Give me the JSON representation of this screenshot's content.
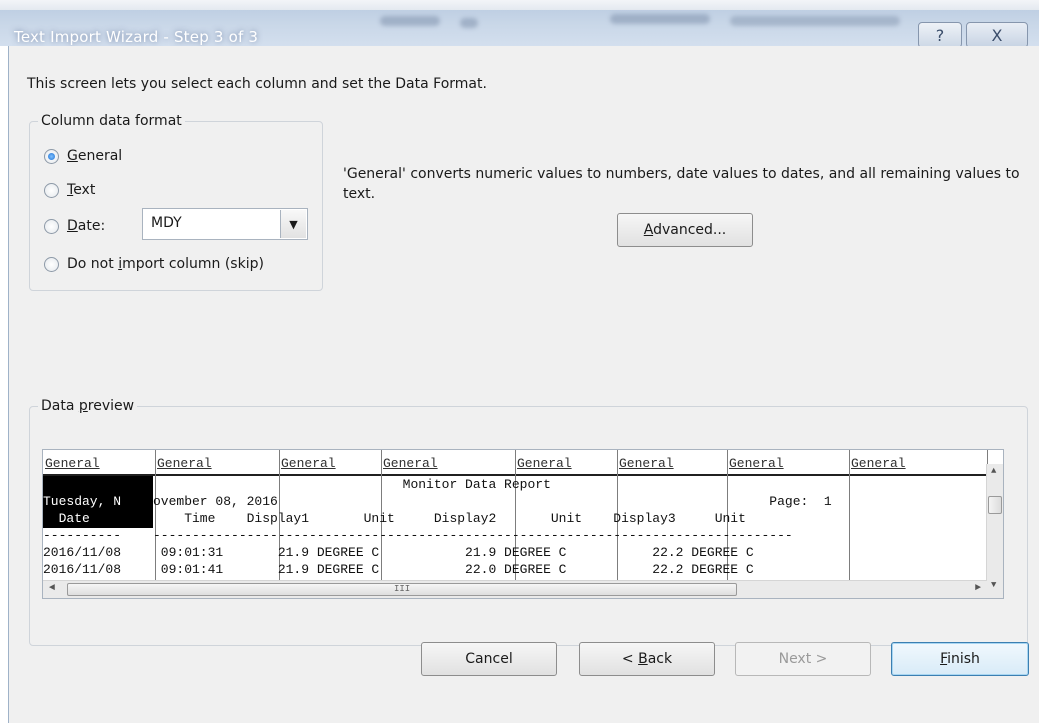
{
  "window": {
    "title": "Text Import Wizard - Step 3 of 3",
    "help_glyph": "?",
    "close_glyph": "X"
  },
  "intro_text": "This screen lets you select each column and set the Data Format.",
  "column_format": {
    "legend": "Column data format",
    "options": [
      {
        "label_mn": "G",
        "label_rest": "eneral",
        "checked": true
      },
      {
        "label_mn": "T",
        "label_rest": "ext",
        "checked": false
      },
      {
        "label_mn": "D",
        "label_rest": "ate:",
        "checked": false
      },
      {
        "label_pre": "Do not ",
        "label_mn": "i",
        "label_rest": "mport column (skip)",
        "checked": false
      }
    ],
    "date_format_value": "MDY",
    "dropdown_glyph": "▼"
  },
  "description": "'General' converts numeric values to numbers, date values to dates, and all remaining values to text.",
  "advanced_button": {
    "mn": "A",
    "rest": "dvanced..."
  },
  "data_preview": {
    "legend_pre": "Data ",
    "legend_mn": "p",
    "legend_rest": "review",
    "headers": [
      "General",
      "General",
      "General",
      "General",
      "General",
      "General",
      "General",
      "General"
    ],
    "col0_lines": [
      "",
      "Tuesday, N",
      "  Date",
      "----------",
      "2016/11/08",
      "2016/11/08"
    ],
    "rest_lines": [
      "                                Monitor Data Report",
      "ovember 08, 2016                                                               Page:  1",
      "    Time    Display1       Unit     Display2       Unit    Display3     Unit",
      "----------------------------------------------------------------------------------",
      " 09:01:31       21.9 DEGREE C           21.9 DEGREE C           22.2 DEGREE C",
      " 09:01:41       21.9 DEGREE C           22.0 DEGREE C           22.2 DEGREE C"
    ],
    "scroll_up": "▲",
    "scroll_down": "▼",
    "scroll_left": "◄",
    "scroll_right": "►",
    "grip": "III"
  },
  "buttons": {
    "cancel": "Cancel",
    "back_pre": "< ",
    "back_mn": "B",
    "back_rest": "ack",
    "next": "Next >",
    "finish_mn": "F",
    "finish_rest": "inish"
  }
}
